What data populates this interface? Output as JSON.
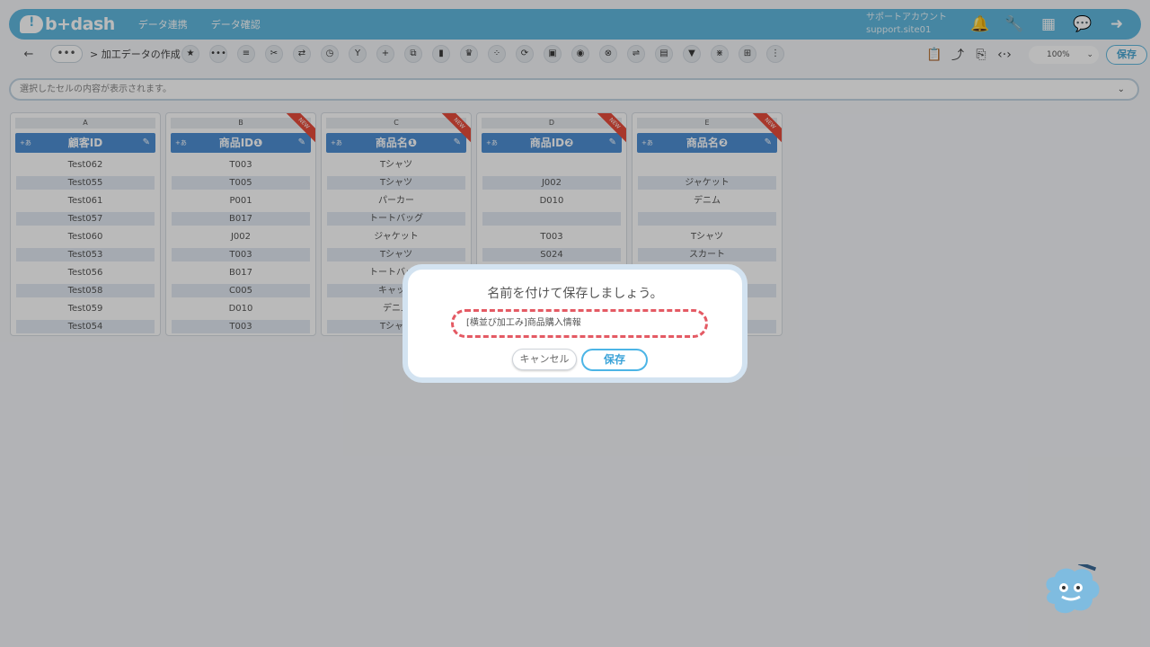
{
  "header": {
    "logo_text": "b+dash",
    "nav": [
      "データ連携",
      "データ確認"
    ],
    "account_name": "サポートアカウント",
    "account_id": "support.site01",
    "icons": [
      "bell-icon",
      "wrench-icon",
      "grid-icon",
      "chat-icon",
      "logout-icon"
    ]
  },
  "toolbar": {
    "back_label": "←",
    "more_label": "•••",
    "breadcrumb": "> 加工データの作成",
    "tools": [
      "★",
      "•••",
      "≡",
      "✂",
      "⇄",
      "◷",
      "Y",
      "+",
      "⧉",
      "▮",
      "♛",
      "⁘",
      "⟳",
      "▣",
      "◉",
      "⊗",
      "⇌",
      "▤",
      "▼",
      "⋇",
      "⊞",
      "⋮"
    ],
    "right_tools": [
      "📋",
      "⤴",
      "⎘",
      "‹·›"
    ],
    "zoom": "100%",
    "save_label": "保存"
  },
  "cellbar": {
    "placeholder": "選択したセルの内容が表示されます。"
  },
  "columns": [
    {
      "letter": "A",
      "header": "顧客ID",
      "header_tag": "+あ",
      "is_new": false,
      "cells": [
        "Test062",
        "Test055",
        "Test061",
        "Test057",
        "Test060",
        "Test053",
        "Test056",
        "Test058",
        "Test059",
        "Test054"
      ]
    },
    {
      "letter": "B",
      "header": "商品ID❶",
      "header_tag": "+あ",
      "is_new": true,
      "cells": [
        "T003",
        "T005",
        "P001",
        "B017",
        "J002",
        "T003",
        "B017",
        "C005",
        "D010",
        "T003"
      ]
    },
    {
      "letter": "C",
      "header": "商品名❶",
      "header_tag": "+あ",
      "is_new": true,
      "cells": [
        "Tシャツ",
        "Tシャツ",
        "パーカー",
        "トートバッグ",
        "ジャケット",
        "Tシャツ",
        "トートバッグ",
        "キャップ",
        "デニム",
        "Tシャツ"
      ]
    },
    {
      "letter": "D",
      "header": "商品ID❷",
      "header_tag": "+あ",
      "is_new": true,
      "cells": [
        "",
        "J002",
        "D010",
        "",
        "T003",
        "S024",
        "",
        "",
        "",
        ""
      ]
    },
    {
      "letter": "E",
      "header": "商品名❷",
      "header_tag": "+あ",
      "is_new": true,
      "cells": [
        "",
        "ジャケット",
        "デニム",
        "",
        "Tシャツ",
        "スカート",
        "",
        "",
        "",
        ""
      ]
    }
  ],
  "new_ribbon": "NEW",
  "dialog": {
    "title": "名前を付けて保存しましょう。",
    "input_value": "[横並び加工み]商品購入情報",
    "cancel_label": "キャンセル",
    "save_label": "保存"
  }
}
